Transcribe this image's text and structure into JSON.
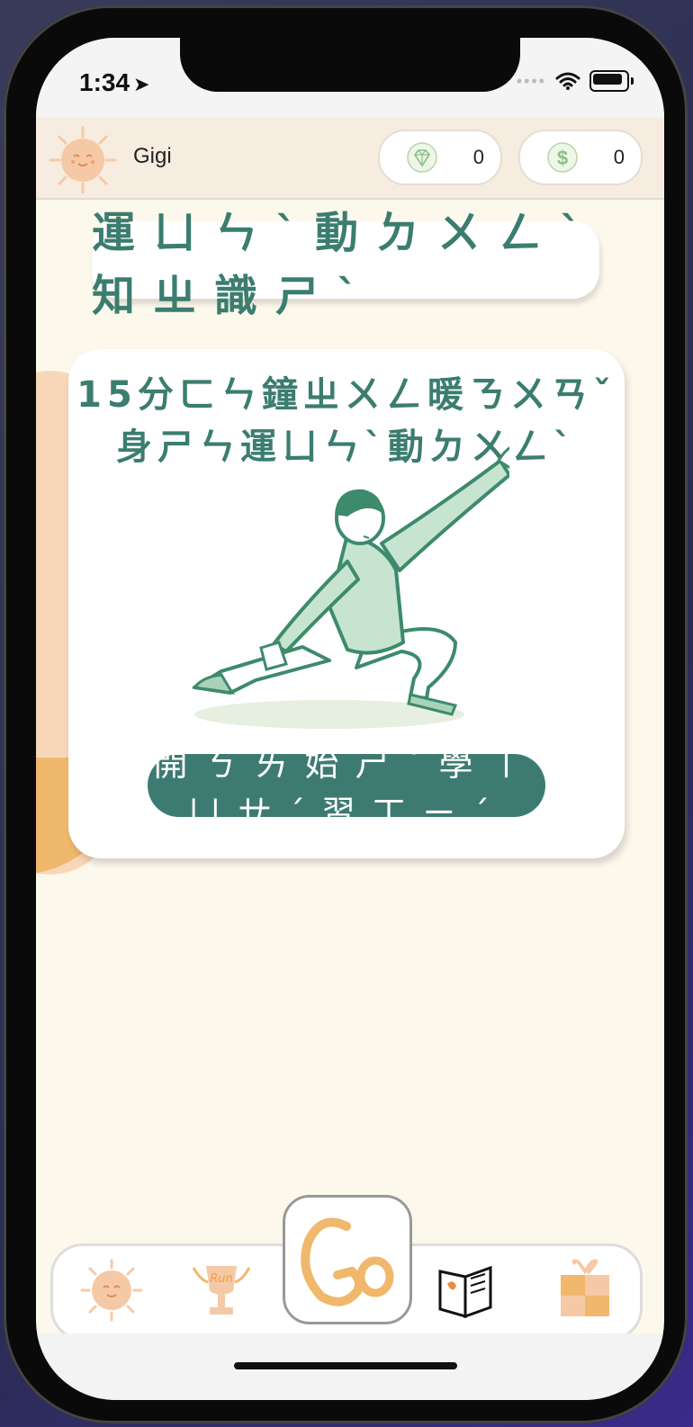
{
  "status_bar": {
    "time": "1:34",
    "location_glyph": "➤"
  },
  "user": {
    "name": "Gigi"
  },
  "currencies": [
    {
      "icon": "diamond-icon",
      "value": "0"
    },
    {
      "icon": "dollar-coin-icon",
      "value": "0"
    }
  ],
  "page": {
    "section_title": "運ㄩㄣˋ動ㄉㄨㄥˋ知ㄓ識ㄕˋ"
  },
  "card": {
    "title": "15分ㄈㄣ鐘ㄓㄨㄥ暖ㄋㄨㄢˇ身ㄕㄣ運ㄩㄣˋ動ㄉㄨㄥˋ",
    "illustration": "stretching-person-illustration",
    "button_label": "開ㄎㄞ始ㄕˇ學ㄒㄩㄝˊ習ㄒㄧˊ"
  },
  "tabbar": {
    "go_label": "Go",
    "trophy_label": "Run",
    "tabs": [
      "sun-home-icon",
      "run-trophy-icon",
      "go-icon",
      "book-icon",
      "gift-icon"
    ]
  },
  "colors": {
    "accent": "#3b7d6f",
    "button": "#3d7b72",
    "background": "#fdf8ec",
    "go": "#f0b86c"
  }
}
